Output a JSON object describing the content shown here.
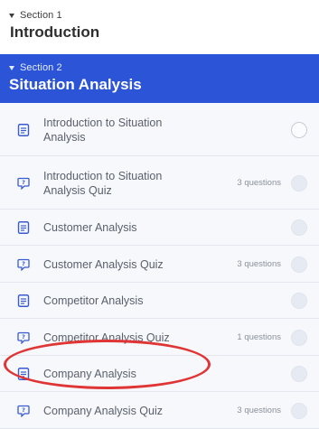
{
  "sections": [
    {
      "label": "Section 1",
      "title": "Introduction"
    },
    {
      "label": "Section 2",
      "title": "Situation Analysis"
    }
  ],
  "lessons": [
    {
      "title_lines": [
        "Introduction to Situation",
        "Analysis"
      ],
      "type": "document",
      "questions": "",
      "status": "not-started"
    },
    {
      "title_lines": [
        "Introduction to Situation",
        "Analysis Quiz"
      ],
      "type": "quiz",
      "questions": "3 questions",
      "status": "locked"
    },
    {
      "title_lines": [
        "Customer Analysis"
      ],
      "type": "document",
      "questions": "",
      "status": "locked"
    },
    {
      "title_lines": [
        "Customer Analysis Quiz"
      ],
      "type": "quiz",
      "questions": "3 questions",
      "status": "locked"
    },
    {
      "title_lines": [
        "Competitor Analysis"
      ],
      "type": "document",
      "questions": "",
      "status": "locked"
    },
    {
      "title_lines": [
        "Competitor Analysis Quiz"
      ],
      "type": "quiz",
      "questions": "1 questions",
      "status": "locked"
    },
    {
      "title_lines": [
        "Company Analysis"
      ],
      "type": "document",
      "questions": "",
      "status": "locked"
    },
    {
      "title_lines": [
        "Company Analysis Quiz"
      ],
      "type": "quiz",
      "questions": "3 questions",
      "status": "locked"
    }
  ],
  "colors": {
    "accent": "#2b54d7",
    "highlight": "#e03535",
    "icon": "#3a5bd0"
  }
}
